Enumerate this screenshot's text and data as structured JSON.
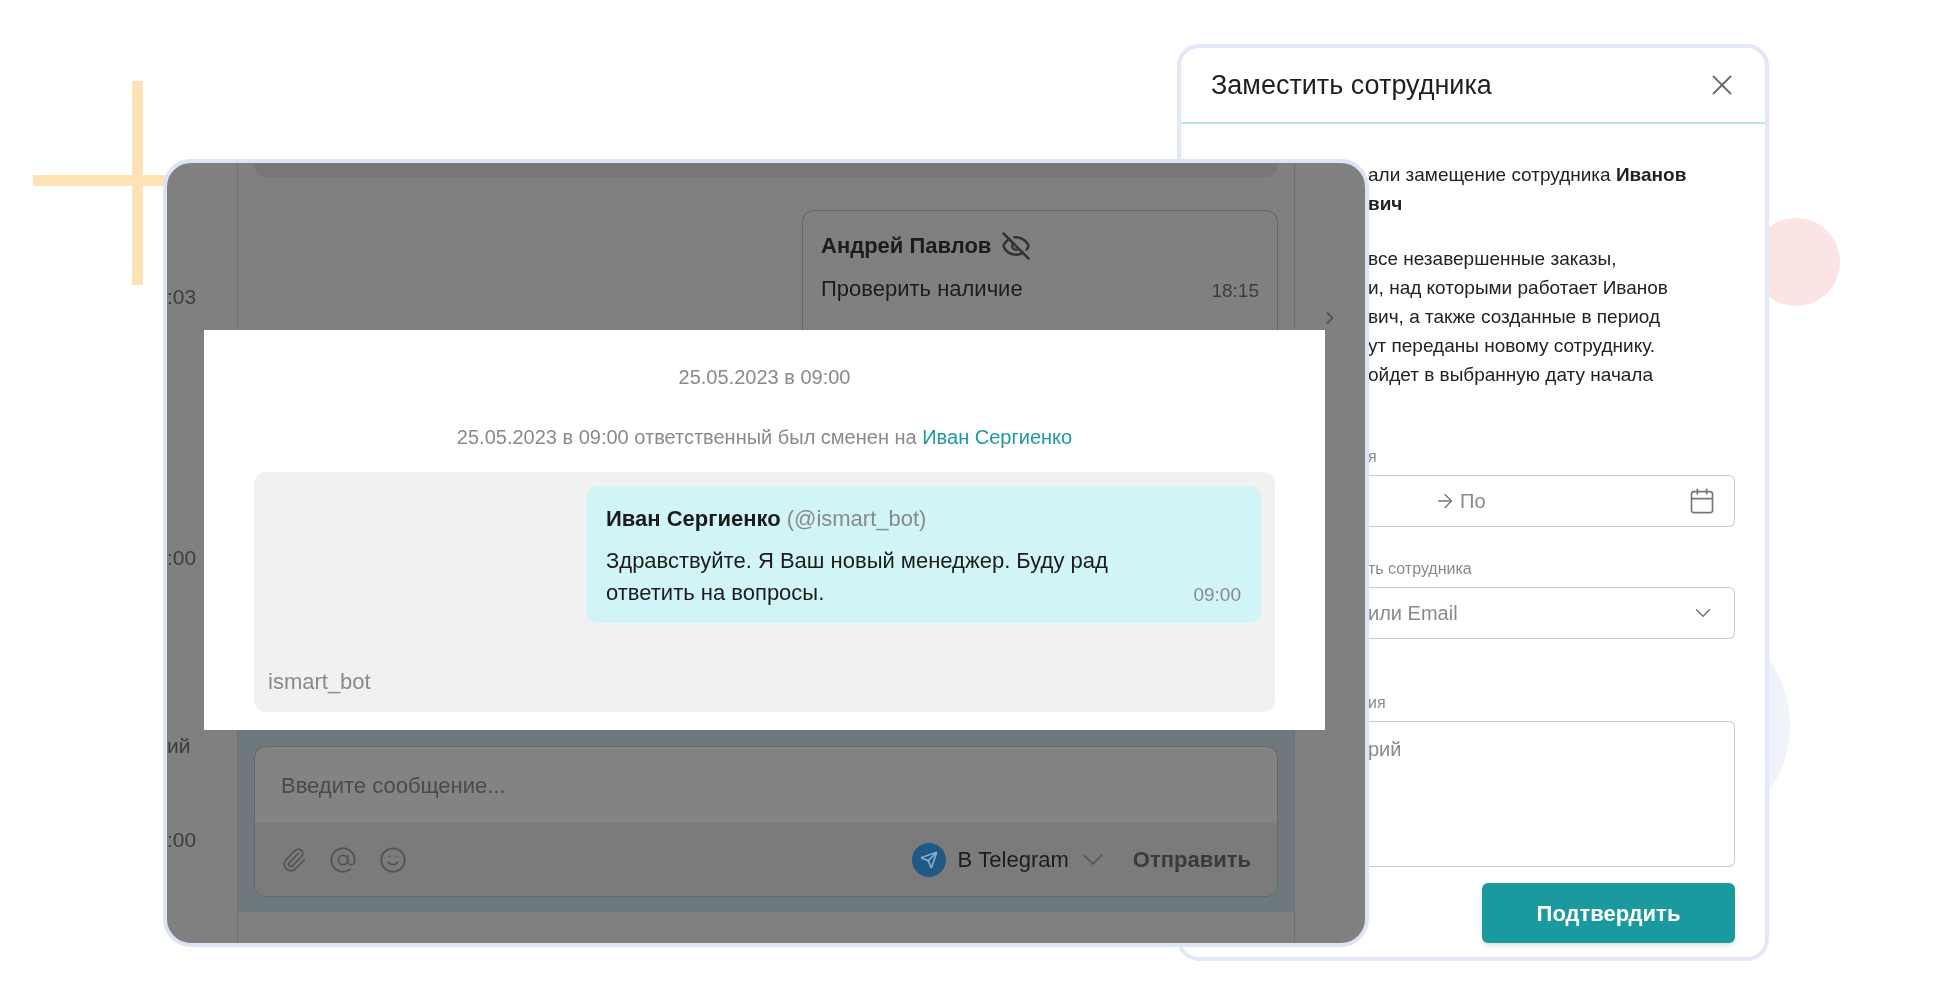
{
  "chat": {
    "side_fragments_top": [
      ":03"
    ],
    "side_fragments_middle": [
      ":00"
    ],
    "side_fragments_bottom": [
      "ий",
      ":00"
    ],
    "prior_message": {
      "author": "Андрей Павлов",
      "text": "Проверить наличие",
      "time": "18:15"
    },
    "date_divider": "25.05.2023 в 09:00",
    "system_note": {
      "text": "25.05.2023 в 09:00 ответственный был сменен на",
      "link": "Иван Сергиенко"
    },
    "message": {
      "author": "Иван Сергиенко",
      "handle": "(@ismart_bot)",
      "text": "Здравствуйте. Я Ваш новый менеджер. Буду рад ответить на вопросы.",
      "time": "09:00"
    },
    "bot_label": "ismart_bot",
    "composer": {
      "placeholder": "Введите сообщение...",
      "channel": "В Telegram",
      "send": "Отправить"
    }
  },
  "dialog": {
    "title": "Заместить сотрудника",
    "paragraphs": [
      [
        "али замещение сотрудника **Иванов**",
        "**вич**"
      ],
      [
        "все незавершенные заказы,",
        "и, над которыми работает Иванов",
        "вич, а также созданные в период",
        "ут переданы новому сотруднику.",
        "ойдет в выбранную дату начала"
      ]
    ],
    "date_field": {
      "label": "я",
      "placeholder": "По"
    },
    "employee_field": {
      "label": "ть сотрудника",
      "placeholder": "или Email"
    },
    "comment_field": {
      "label": "ия",
      "placeholder": "рий"
    },
    "confirm": "Подтвердить"
  }
}
